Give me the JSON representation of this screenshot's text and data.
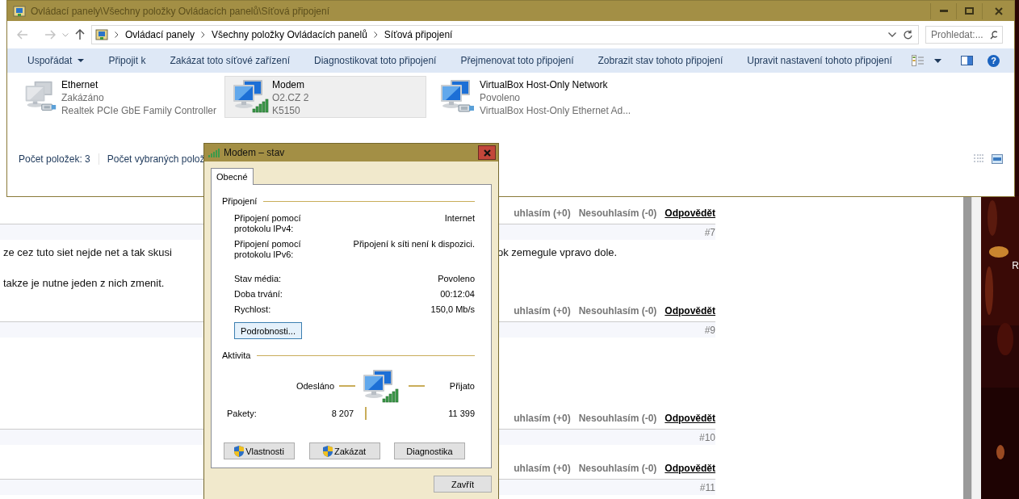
{
  "web_page": {
    "comments": [
      {
        "votes": {
          "agree": "uhlasím (+0)",
          "disagree": "Nesouhlasím (-0)",
          "reply": "Odpovědět"
        },
        "number": "#7"
      },
      {
        "body": [
          {
            "left": "ze cez tuto siet nejde net a tak skusi",
            "right": "ok zemegule vpravo dole."
          },
          {
            "left": "takze je nutne jeden z nich zmenit."
          }
        ],
        "votes": {
          "agree": "uhlasím (+0)",
          "disagree": "Nesouhlasím (-0)",
          "reply": "Odpovědět"
        },
        "number": "#9"
      },
      {
        "votes": {
          "agree": "uhlasím (+0)",
          "disagree": "Nesouhlasím (-0)",
          "reply": "Odpovědět"
        },
        "number": "#10"
      },
      {
        "votes": {
          "agree": "uhlasím (+0)",
          "disagree": "Nesouhlasím (-0)",
          "reply": "Odpovědět"
        },
        "number": "#11"
      }
    ]
  },
  "desktop": {
    "kind": "picture",
    "icon_label": "R"
  },
  "explorer": {
    "title": "Ovládací panely\\Všechny položky Ovládacích panelů\\Síťová připojení",
    "breadcrumbs": [
      "Ovládací panely",
      "Všechny položky Ovládacích panelů",
      "Síťová připojení"
    ],
    "search": {
      "placeholder": "Prohledat:..."
    },
    "toolbar": [
      {
        "label": "Uspořádat",
        "dropdown": true
      },
      {
        "label": "Připojit k",
        "dropdown": false
      },
      {
        "label": "Zakázat toto síťové zařízení",
        "dropdown": false
      },
      {
        "label": "Diagnostikovat toto připojení",
        "dropdown": false
      },
      {
        "label": "Přejmenovat toto připojení",
        "dropdown": false
      },
      {
        "label": "Zobrazit stav tohoto připojení",
        "dropdown": false
      },
      {
        "label": "Upravit nastavení tohoto připojení",
        "dropdown": false
      }
    ],
    "help": "?",
    "items": [
      {
        "name": "Ethernet",
        "status": "Zakázáno",
        "device": "Realtek PCIe GbE Family Controller",
        "kind": "ethernet",
        "disabled": true,
        "selected": false
      },
      {
        "name": "Modem",
        "status": "O2.CZ 2",
        "device": "K5150",
        "kind": "wireless",
        "disabled": false,
        "selected": true
      },
      {
        "name": "VirtualBox Host-Only Network",
        "status": "Povoleno",
        "device": "VirtualBox Host-Only Ethernet Ad...",
        "kind": "ethernet",
        "disabled": false,
        "selected": false
      }
    ],
    "status_bar": [
      "Počet položek: 3",
      "Počet vybraných polož"
    ]
  },
  "status_dialog": {
    "title": "Modem – stav",
    "tabs": [
      {
        "label": "Obecné",
        "selected": true
      }
    ],
    "connection": {
      "heading": "Připojení",
      "rows": [
        {
          "label": "Připojení pomocí protokolu IPv4:",
          "value": "Internet"
        },
        {
          "label": "Připojení pomocí protokolu IPv6:",
          "value": "Připojení k síti není k dispozici."
        },
        {
          "label": "Stav média:",
          "value": "Povoleno"
        },
        {
          "label": "Doba trvání:",
          "value": "00:12:04"
        },
        {
          "label": "Rychlost:",
          "value": "150,0 Mb/s"
        }
      ],
      "details_button": "Podrobnosti..."
    },
    "activity": {
      "heading": "Aktivita",
      "sent_label": "Odesláno",
      "received_label": "Přijato",
      "packets_label": "Pakety:",
      "sent": "8 207",
      "received": "11 399"
    },
    "buttons": [
      {
        "label": "Vlastnosti",
        "shield": true
      },
      {
        "label": "Zakázat",
        "shield": true
      },
      {
        "label": "Diagnostika",
        "shield": false
      }
    ],
    "close_button": "Zavřít"
  }
}
